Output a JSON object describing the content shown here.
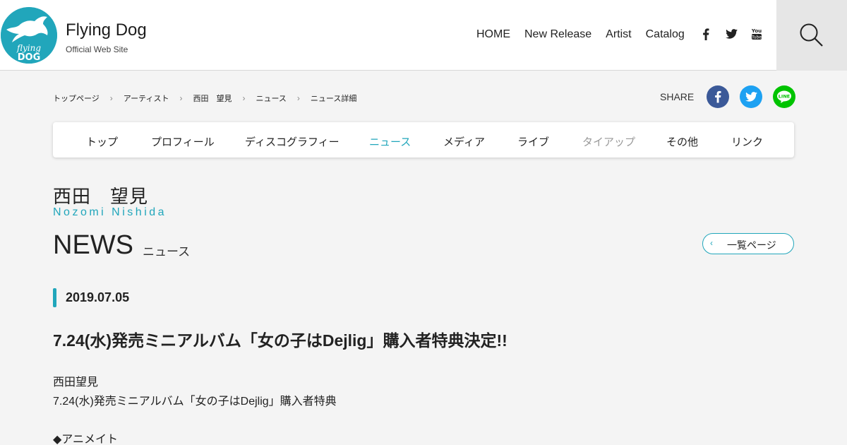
{
  "header": {
    "title": "Flying Dog",
    "subtitle": "Official Web Site",
    "logo_text": "flying DOG",
    "nav": [
      "HOME",
      "New Release",
      "Artist",
      "Catalog"
    ],
    "social": [
      "facebook-icon",
      "twitter-icon",
      "youtube-icon"
    ]
  },
  "breadcrumb": [
    "トップページ",
    "アーティスト",
    "西田　望見",
    "ニュース",
    "ニュース詳細"
  ],
  "share": {
    "label": "SHARE",
    "line_text": "LINE"
  },
  "artist_nav": [
    "トップ",
    "プロフィール",
    "ディスコグラフィー",
    "ニュース",
    "メディア",
    "ライブ",
    "タイアップ",
    "その他",
    "リンク"
  ],
  "artist": {
    "name": "西田　望見",
    "roman": "Nozomi Nishida"
  },
  "section": {
    "title_en": "NEWS",
    "title_ja": "ニュース",
    "back_label": "一覧ページ"
  },
  "article": {
    "date": "2019.07.05",
    "headline": "7.24(水)発売ミニアルバム「女の子はDejlig」購入者特典決定!!",
    "body": [
      "西田望見",
      "7.24(水)発売ミニアルバム「女の子はDejlig」購入者特典",
      "",
      "◆アニメイト"
    ]
  },
  "colors": {
    "accent": "#21a6bb",
    "facebook": "#3b5998",
    "twitter": "#1da1f2",
    "line": "#00c300"
  }
}
